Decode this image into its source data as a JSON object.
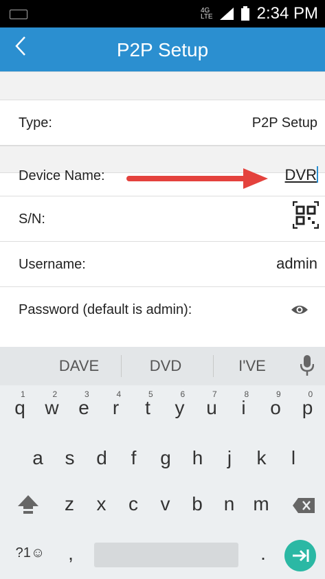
{
  "status_bar": {
    "network": "4G LTE",
    "time": "2:34 PM"
  },
  "header": {
    "title": "P2P Setup"
  },
  "form": {
    "type_label": "Type:",
    "type_value": "P2P Setup",
    "device_name_label": "Device Name:",
    "device_name_value": "DVR",
    "sn_label": "S/N:",
    "username_label": "Username:",
    "username_value": "admin",
    "password_label": "Password (default is admin):"
  },
  "keyboard": {
    "suggestions": [
      "DAVE",
      "DVD",
      "I'VE"
    ],
    "row1": [
      [
        "q",
        "1"
      ],
      [
        "w",
        "2"
      ],
      [
        "e",
        "3"
      ],
      [
        "r",
        "4"
      ],
      [
        "t",
        "5"
      ],
      [
        "y",
        "6"
      ],
      [
        "u",
        "7"
      ],
      [
        "i",
        "8"
      ],
      [
        "o",
        "9"
      ],
      [
        "p",
        "0"
      ]
    ],
    "row2": [
      "a",
      "s",
      "d",
      "f",
      "g",
      "h",
      "j",
      "k",
      "l"
    ],
    "row3": [
      "z",
      "x",
      "c",
      "v",
      "b",
      "n",
      "m"
    ],
    "symbols_label": "?1☺",
    "comma": ",",
    "period": "."
  },
  "colors": {
    "appbar": "#2b8fd0",
    "arrow": "#e4423d",
    "enter": "#2bb8a4"
  }
}
